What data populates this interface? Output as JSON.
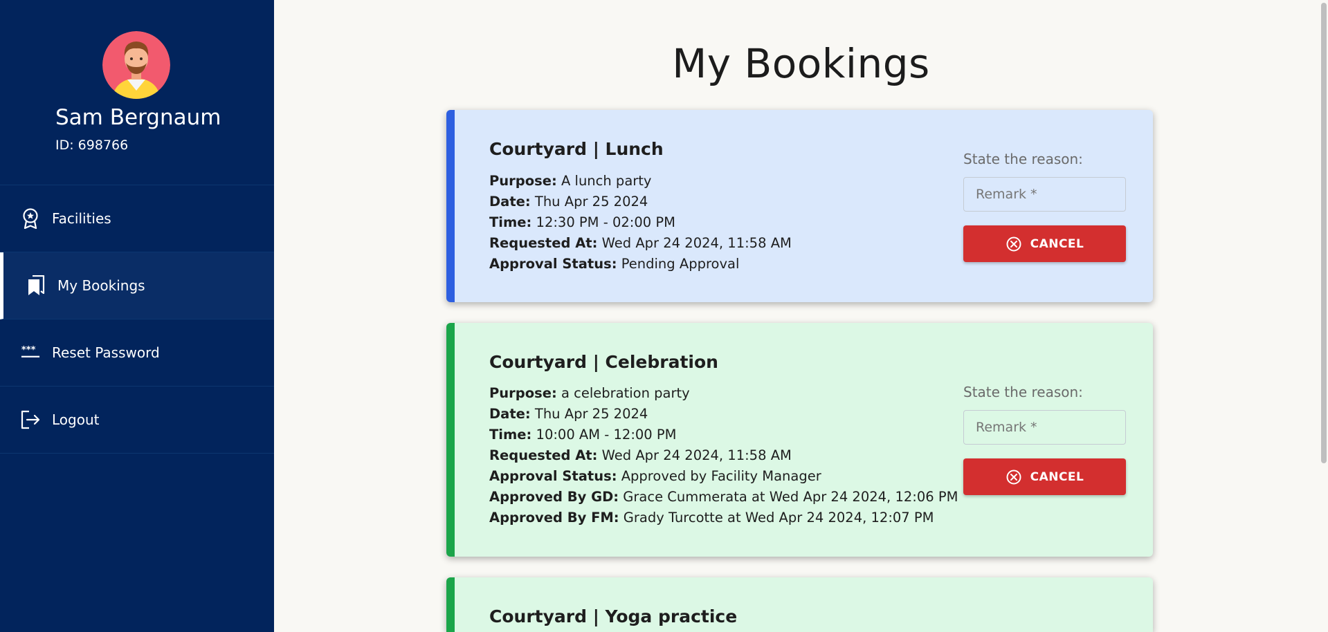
{
  "sidebar": {
    "user": {
      "name": "Sam Bergnaum",
      "id": "ID: 698766"
    },
    "items": [
      {
        "label": "Facilities",
        "icon": "award-icon"
      },
      {
        "label": "My Bookings",
        "icon": "bookmarks-icon",
        "active": true
      },
      {
        "label": "Reset Password",
        "icon": "password-icon"
      },
      {
        "label": "Logout",
        "icon": "logout-icon"
      }
    ]
  },
  "main": {
    "title": "My Bookings",
    "reason_label": "State the reason:",
    "remark_placeholder": "Remark *",
    "cancel_label": "CANCEL",
    "bookings": [
      {
        "title": "Courtyard | Lunch",
        "status_color": "#2d5fe0",
        "fields": [
          {
            "label": "Purpose:",
            "value": "A lunch party"
          },
          {
            "label": "Date:",
            "value": "Thu Apr 25 2024"
          },
          {
            "label": "Time:",
            "value": "12:30 PM - 02:00 PM"
          },
          {
            "label": "Requested At:",
            "value": "Wed Apr 24 2024, 11:58 AM"
          },
          {
            "label": "Approval Status:",
            "value": "Pending Approval"
          }
        ]
      },
      {
        "title": "Courtyard | Celebration",
        "status_color": "#1ba54a",
        "fields": [
          {
            "label": "Purpose:",
            "value": "a celebration party"
          },
          {
            "label": "Date:",
            "value": "Thu Apr 25 2024"
          },
          {
            "label": "Time:",
            "value": "10:00 AM - 12:00 PM"
          },
          {
            "label": "Requested At:",
            "value": "Wed Apr 24 2024, 11:58 AM"
          },
          {
            "label": "Approval Status:",
            "value": "Approved by Facility Manager"
          },
          {
            "label": "Approved By GD:",
            "value": "Grace Cummerata at Wed Apr 24 2024, 12:06 PM"
          },
          {
            "label": "Approved By FM:",
            "value": "Grady Turcotte at Wed Apr 24 2024, 12:07 PM"
          }
        ]
      },
      {
        "title": "Courtyard | Yoga practice",
        "status_color": "#1ba54a",
        "fields": []
      }
    ]
  }
}
